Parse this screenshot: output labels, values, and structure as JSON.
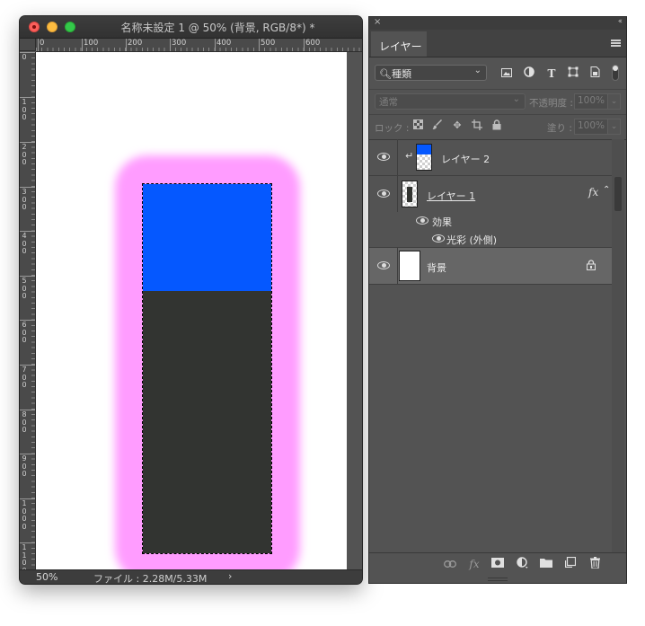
{
  "document": {
    "title": "名称未設定 1 @ 50% (背景, RGB/8*) *",
    "ruler_top_labels": [
      "0",
      "100",
      "200",
      "300",
      "400",
      "500",
      "600"
    ],
    "ruler_left_labels": [
      "0",
      "100",
      "200",
      "300",
      "400",
      "500",
      "600",
      "700",
      "800",
      "900",
      "1000",
      "1100"
    ],
    "zoom": "50%",
    "file_info": "ファイル : 2.28M/5.33M",
    "status_arrow": "›",
    "colors": {
      "layer1_fill": "#323431",
      "layer2_fill": "#0558ff",
      "outer_glow": "#ff9cff",
      "canvas": "#ffffff"
    }
  },
  "panel": {
    "close": "×",
    "collapse": "‹‹",
    "tab_label": "レイヤー",
    "filter": {
      "kind_label": "種類",
      "icons": [
        "image-filter-icon",
        "adjustment-filter-icon",
        "type-filter-icon",
        "shape-filter-icon",
        "smart-object-filter-icon"
      ]
    },
    "blend_mode": "通常",
    "opacity_label": "不透明度 :",
    "opacity_value": "100%",
    "lock_label": "ロック :",
    "fill_label": "塗り :",
    "fill_value": "100%",
    "layers": [
      {
        "name": "レイヤー 2",
        "clipped": true,
        "color": "#0558ff"
      },
      {
        "name": "レイヤー 1",
        "fx": "fx",
        "effects_label": "効果",
        "effect_name": "光彩 (外側)"
      },
      {
        "name": "背景",
        "locked": true
      }
    ]
  }
}
